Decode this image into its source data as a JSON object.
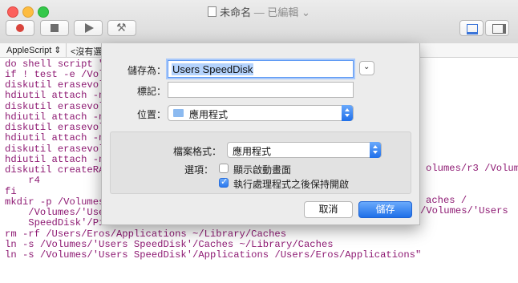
{
  "window": {
    "title": "未命名",
    "edited_label": "— 已編輯",
    "edited_chevron": "⌄"
  },
  "toolbar": {
    "compile_glyph": "⚒"
  },
  "navbar": {
    "language": "AppleScript ⇕",
    "element": "<沒有選"
  },
  "editor_lines": [
    "do shell script \"",
    "if ! test -e /Volum",
    "diskutil erasevolu",
    "hdiutil attach -nor",
    "diskutil erasevolu",
    "hdiutil attach -nor",
    "diskutil erasevolu",
    "hdiutil attach -nor",
    "diskutil erasevolu",
    "hdiutil attach -nor",
    "diskutil createRAI",
    "    r4",
    "fi",
    "mkdir -p /Volumes/",
    "    /Volumes/'Users",
    "    SpeedDisk'/Pict",
    "rm -rf /Users/Eros/Applications ~/Library/Caches",
    "ln -s /Volumes/'Users SpeedDisk'/Caches ~/Library/Caches",
    "ln -s /Volumes/'Users SpeedDisk'/Applications /Users/Eros/Applications\""
  ],
  "editor_right": {
    "line10": "olumes/r3 /Volumes/",
    "line13": "aches /",
    "line14": "/Volumes/'Users"
  },
  "save_sheet": {
    "save_as_label": "儲存為：",
    "save_as_value": "Users SpeedDisk",
    "tags_label": "標記：",
    "tags_value": "",
    "where_label": "位置：",
    "where_value": "應用程式",
    "expand_glyph": "⌄",
    "file_format_label": "檔案格式：",
    "file_format_value": "應用程式",
    "options_label": "選項：",
    "options": [
      {
        "label": "顯示啟動畫面",
        "checked": false
      },
      {
        "label": "執行處理程式之後保持開啟",
        "checked": true
      }
    ],
    "cancel_label": "取消",
    "save_label": "儲存"
  },
  "colors": {
    "script_text": "#8e1a73",
    "accent": "#2a78ee"
  }
}
